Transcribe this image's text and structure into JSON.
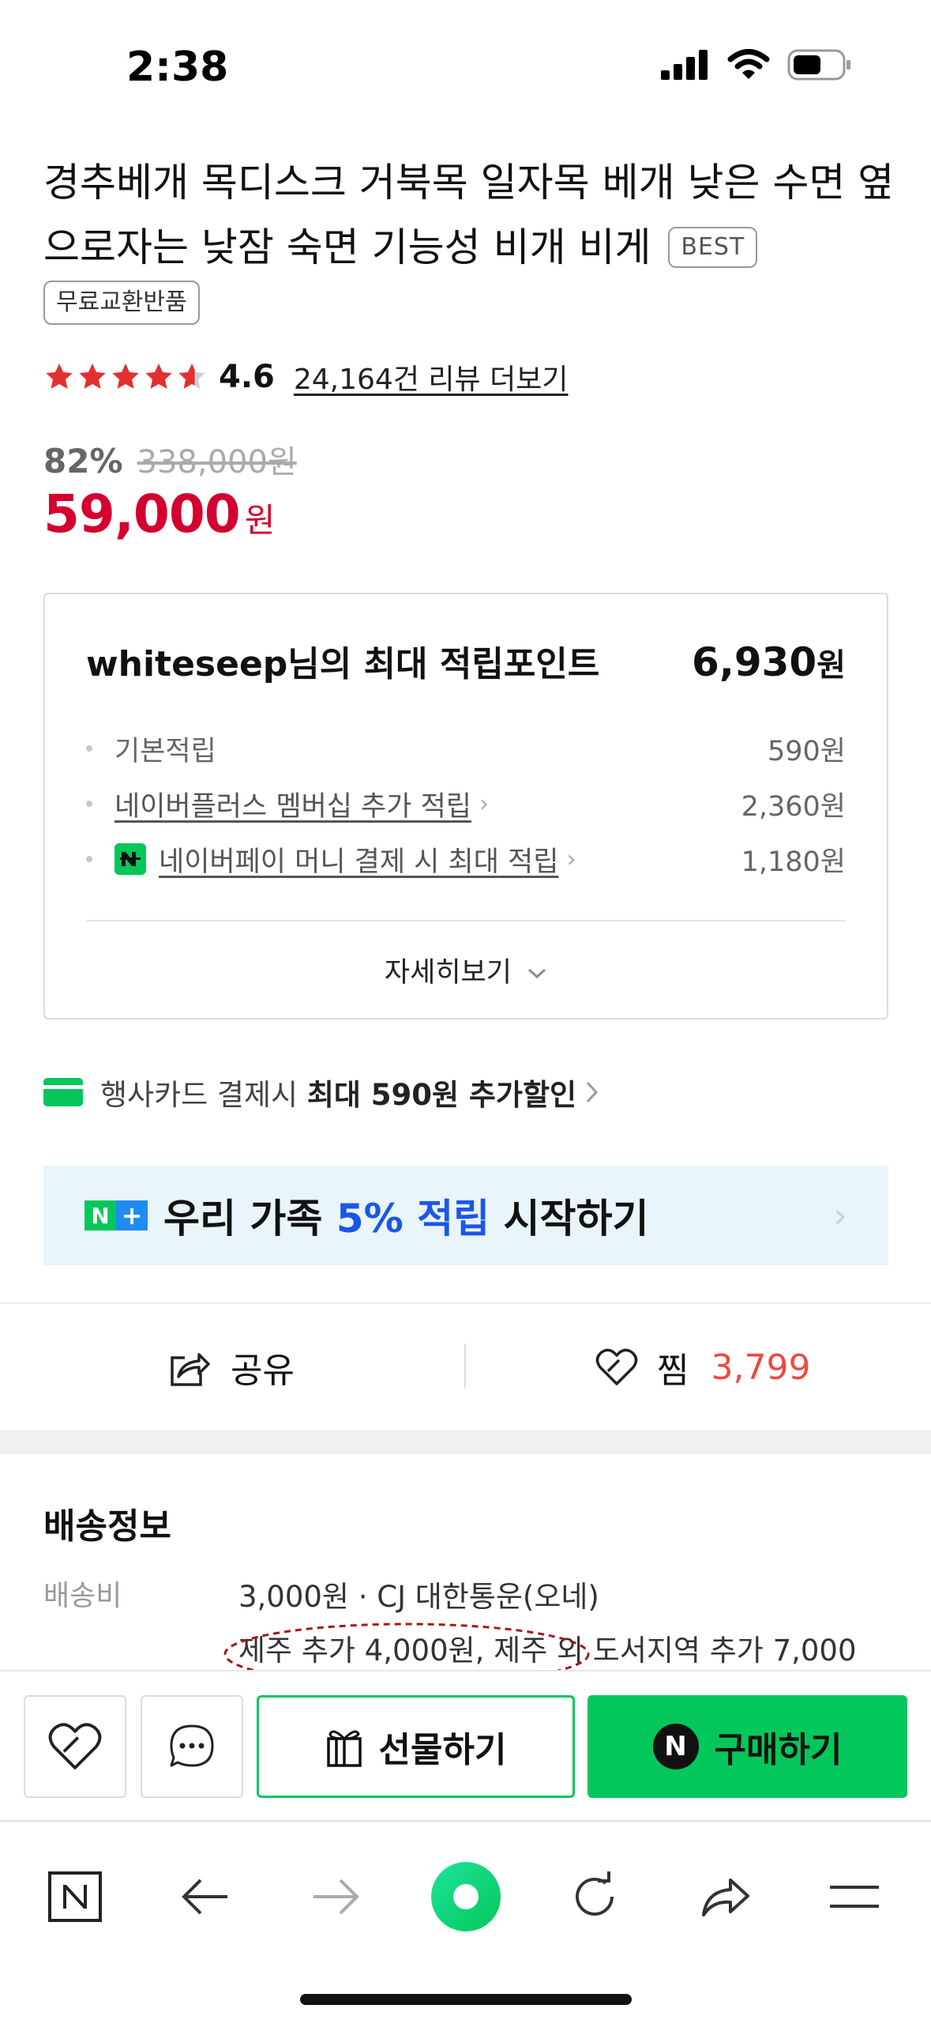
{
  "status_bar": {
    "time": "2:38"
  },
  "product": {
    "title": "경추베개 목디스크 거북목 일자목 베개 낮은 수면 옆으로자는 낮잠 숙면 기능성 비개 비게",
    "best_badge": "BEST",
    "exchange_badge": "무료교환반품",
    "rating": "4.6",
    "rating_value": 4.6,
    "review_link": "24,164건 리뷰 더보기",
    "discount_rate": "82%",
    "original_price": "338,000원",
    "sale_price": "59,000",
    "sale_unit": "원"
  },
  "points": {
    "title": "whiteseep님의 최대 적립포인트",
    "total": "6,930",
    "total_unit": "원",
    "items": [
      {
        "label": "기본적립",
        "value": "590원"
      },
      {
        "label": "네이버플러스 멤버십 추가 적립",
        "value": "2,360원"
      },
      {
        "label": "네이버페이 머니 결제 시 최대 적립",
        "value": "1,180원"
      }
    ],
    "details_label": "자세히보기"
  },
  "card_discount": {
    "prefix": "행사카드 결제시 ",
    "highlight": "최대 590원 추가할인"
  },
  "banner": {
    "text_before": "우리 가족 ",
    "highlight": "5% 적립",
    "text_after": " 시작하기"
  },
  "actions": {
    "share_label": "공유",
    "zzim_label": "찜",
    "zzim_count": "3,799"
  },
  "delivery": {
    "title": "배송정보",
    "fee_label": "배송비",
    "fee_value": "3,000원 · CJ 대한통운(오네)",
    "extra_info": "제주 추가 4,000원, 제주 외 도서지역 추가 7,000"
  },
  "purchase_bar": {
    "gift_label": "선물하기",
    "buy_label": "구매하기",
    "buy_icon_letter": "N"
  },
  "colors": {
    "brand_green": "#03c75a",
    "price_red": "#d3002f",
    "zzim_red": "#f0483e",
    "banner_blue": "#1a56e8"
  },
  "icons": [
    "signal-icon",
    "wifi-icon",
    "battery-icon",
    "star-icon",
    "chevron-right-icon",
    "chevron-down-icon",
    "share-icon",
    "heart-icon",
    "chat-icon",
    "gift-icon",
    "naver-n-icon",
    "back-arrow-icon",
    "forward-arrow-icon",
    "home-dot-icon",
    "reload-icon",
    "forward-share-icon",
    "menu-icon"
  ]
}
